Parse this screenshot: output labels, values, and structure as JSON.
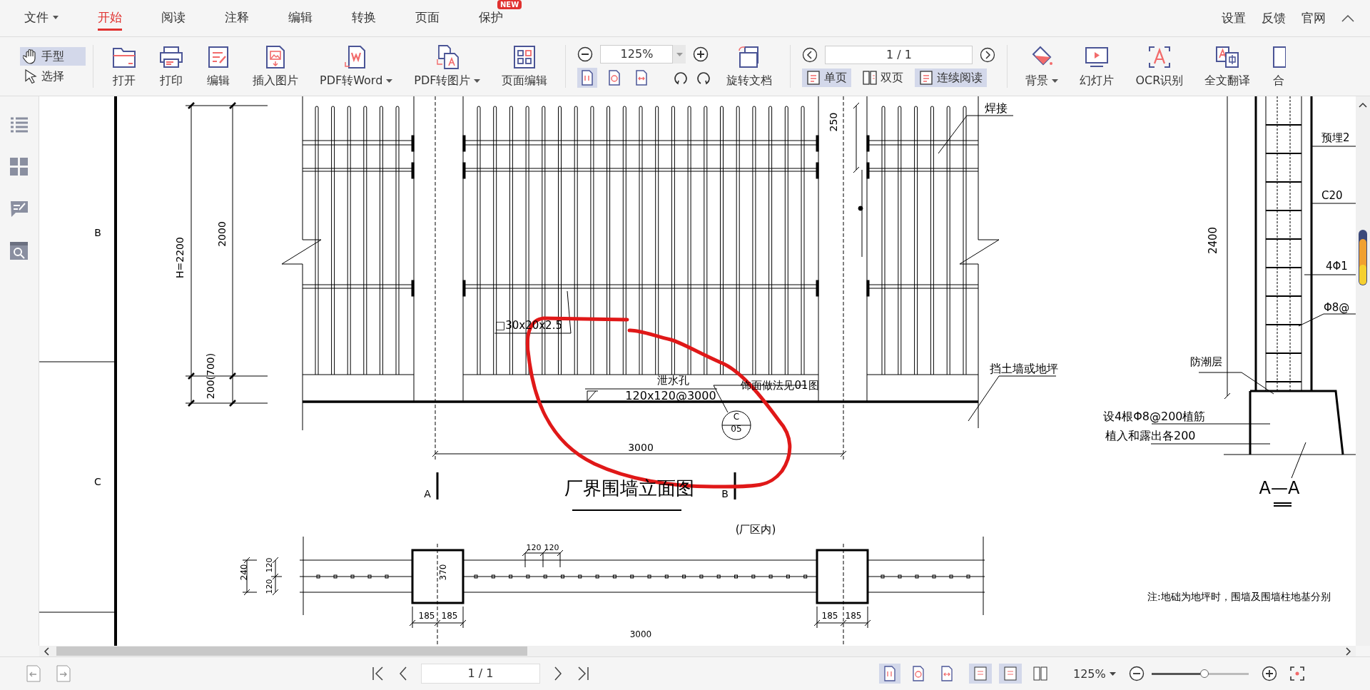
{
  "menu": {
    "items": [
      {
        "label": "文件",
        "selected": false,
        "dropdown": true
      },
      {
        "label": "开始",
        "selected": true,
        "dropdown": false
      },
      {
        "label": "阅读",
        "selected": false,
        "dropdown": false
      },
      {
        "label": "注释",
        "selected": false,
        "dropdown": false
      },
      {
        "label": "编辑",
        "selected": false,
        "dropdown": false
      },
      {
        "label": "转换",
        "selected": false,
        "dropdown": false
      },
      {
        "label": "页面",
        "selected": false,
        "dropdown": false
      },
      {
        "label": "保护",
        "selected": false,
        "dropdown": false,
        "badge": "NEW"
      }
    ],
    "right_links": [
      "设置",
      "反馈",
      "官网"
    ]
  },
  "toolbar": {
    "tools": [
      {
        "label": "手型",
        "selected": true
      },
      {
        "label": "选择",
        "selected": false
      }
    ],
    "buttons": [
      {
        "label": "打开",
        "dropdown": false
      },
      {
        "label": "打印",
        "dropdown": false
      },
      {
        "label": "编辑",
        "dropdown": false
      },
      {
        "label": "插入图片",
        "dropdown": false
      },
      {
        "label": "PDF转Word",
        "dropdown": true
      },
      {
        "label": "PDF转图片",
        "dropdown": true
      },
      {
        "label": "页面编辑",
        "dropdown": false
      }
    ],
    "zoom": {
      "value": "125%"
    },
    "fit_buttons": [
      {
        "selected": true
      },
      {
        "selected": false
      },
      {
        "selected": false
      }
    ],
    "rotate_button": "旋转文档",
    "page": {
      "value": "1 / 1"
    },
    "layouts": [
      {
        "label": "单页",
        "selected": true
      },
      {
        "label": "双页",
        "selected": false
      },
      {
        "label": "连续阅读",
        "selected": true
      }
    ],
    "buttons_right": [
      {
        "label": "背景",
        "dropdown": true
      },
      {
        "label": "幻灯片",
        "dropdown": false
      },
      {
        "label": "OCR识别",
        "dropdown": false
      },
      {
        "label": "全文翻译",
        "dropdown": false
      },
      {
        "label": "合",
        "dropdown": false
      }
    ]
  },
  "document": {
    "frame_labels": [
      "B",
      "C"
    ],
    "labels": [
      "H=2200",
      "2000",
      "200(700)",
      "□30x20x2.5",
      "泄水孔",
      "120x120@3000",
      "饰面做法见01图",
      "C",
      "05",
      "3000",
      "A",
      "厂界围墙立面图",
      "B",
      "(厂区内)",
      "焊接",
      "250",
      "挡土墙或地坪",
      "2400",
      "预埋2",
      "C20",
      "4Φ1",
      "Φ8@",
      "防潮层",
      "设4根Φ8@200植筋",
      "植入和露出各200",
      "A—A",
      "120",
      "120",
      "240",
      "120",
      "120",
      "370",
      "185",
      "185",
      "185",
      "185",
      "3000",
      "注:地础为地坪时，围墙及围墙柱地基分别"
    ]
  },
  "status_bar": {
    "page": "1 / 1",
    "view_buttons": [
      {
        "selected": true
      },
      {
        "selected": false
      },
      {
        "selected": false
      }
    ],
    "layout_buttons": [
      {
        "selected": true
      },
      {
        "selected": true
      },
      {
        "selected": false
      }
    ],
    "zoom": "125%",
    "zoom_slider": {
      "level": 0.5
    }
  }
}
